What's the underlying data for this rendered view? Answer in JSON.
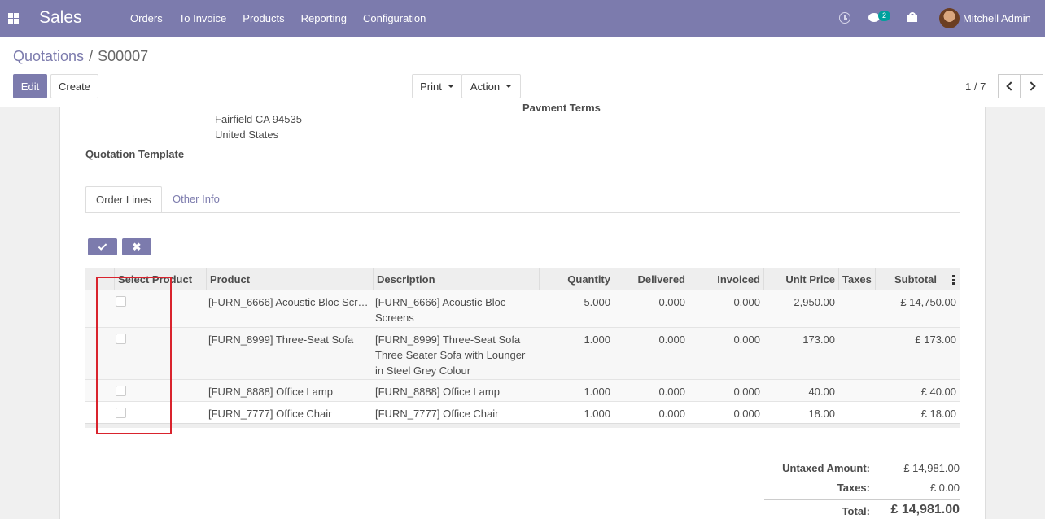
{
  "navbar": {
    "app_name": "Sales",
    "menu": [
      "Orders",
      "To Invoice",
      "Products",
      "Reporting",
      "Configuration"
    ],
    "chat_count": "2",
    "user_name": "Mitchell Admin",
    "color": "#7c7bad"
  },
  "breadcrumb": {
    "parent": "Quotations",
    "separator": "/",
    "current": "S00007"
  },
  "buttons": {
    "edit": "Edit",
    "create": "Create",
    "print": "Print",
    "action": "Action"
  },
  "pager": {
    "value": "1 / 7"
  },
  "form": {
    "address_line1": "Fairfield CA 94535",
    "address_line2": "United States",
    "quotation_template_label": "Quotation Template",
    "payment_terms_label": "Payment Terms"
  },
  "tabs": [
    "Order Lines",
    "Other Info"
  ],
  "table": {
    "headers": {
      "select": "Select Product",
      "product": "Product",
      "description": "Description",
      "quantity": "Quantity",
      "delivered": "Delivered",
      "invoiced": "Invoiced",
      "unit_price": "Unit Price",
      "taxes": "Taxes",
      "subtotal": "Subtotal"
    },
    "rows": [
      {
        "product": "[FURN_6666] Acoustic Bloc Scr…",
        "description": "[FURN_6666] Acoustic Bloc Screens",
        "quantity": "5.000",
        "delivered": "0.000",
        "invoiced": "0.000",
        "unit_price": "2,950.00",
        "taxes": "",
        "subtotal": "£ 14,750.00"
      },
      {
        "product": "[FURN_8999] Three-Seat Sofa",
        "description": "[FURN_8999] Three-Seat Sofa Three Seater Sofa with Lounger in Steel Grey Colour",
        "quantity": "1.000",
        "delivered": "0.000",
        "invoiced": "0.000",
        "unit_price": "173.00",
        "taxes": "",
        "subtotal": "£ 173.00"
      },
      {
        "product": "[FURN_8888] Office Lamp",
        "description": "[FURN_8888] Office Lamp",
        "quantity": "1.000",
        "delivered": "0.000",
        "invoiced": "0.000",
        "unit_price": "40.00",
        "taxes": "",
        "subtotal": "£ 40.00"
      },
      {
        "product": "[FURN_7777] Office Chair",
        "description": "[FURN_7777] Office Chair",
        "quantity": "1.000",
        "delivered": "0.000",
        "invoiced": "0.000",
        "unit_price": "18.00",
        "taxes": "",
        "subtotal": "£ 18.00"
      }
    ]
  },
  "totals": {
    "untaxed_label": "Untaxed Amount:",
    "untaxed_value": "£ 14,981.00",
    "taxes_label": "Taxes:",
    "taxes_value": "£ 0.00",
    "total_label": "Total:",
    "total_value": "£ 14,981.00"
  },
  "highlight_color": "#d9232d"
}
